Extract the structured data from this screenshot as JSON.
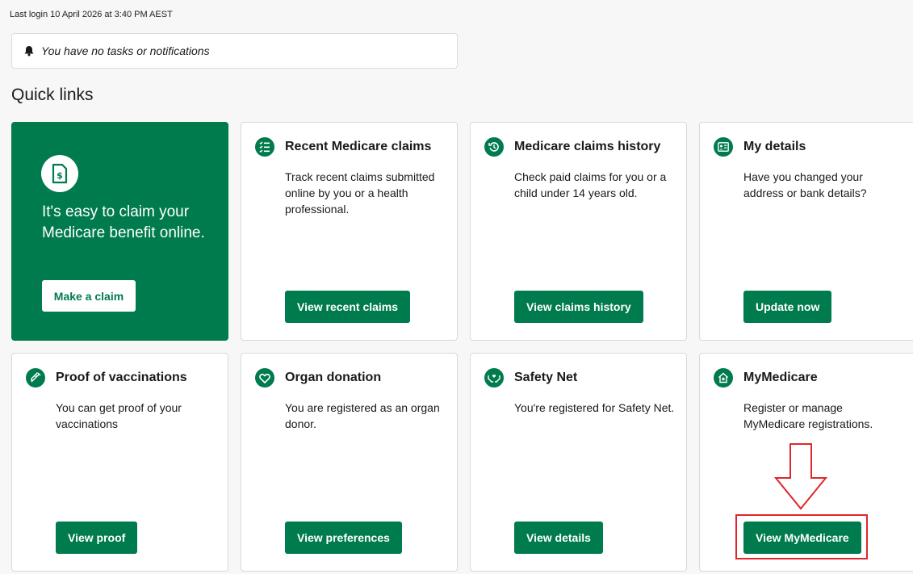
{
  "last_login": "Last login 10 April 2026 at 3:40 PM AEST",
  "notifications": {
    "text": "You have no tasks or notifications",
    "icon": "bell-icon"
  },
  "quick_links": {
    "heading": "Quick links",
    "hero": {
      "icon": "claim-document-icon",
      "text": "It's easy to claim your Medicare benefit online.",
      "button": "Make a claim"
    },
    "cards": [
      {
        "icon": "checklist-icon",
        "title": "Recent Medicare claims",
        "description": "Track recent claims submitted online by you or a health professional.",
        "button": "View recent claims"
      },
      {
        "icon": "history-icon",
        "title": "Medicare claims history",
        "description": "Check paid claims for you or a child under 14 years old.",
        "button": "View claims history"
      },
      {
        "icon": "id-card-icon",
        "title": "My details",
        "description": "Have you changed your address or bank details?",
        "button": "Update now"
      },
      {
        "icon": "syringe-icon",
        "title": "Proof of vaccinations",
        "description": "You can get proof of your vaccinations",
        "button": "View proof"
      },
      {
        "icon": "heart-icon",
        "title": "Organ donation",
        "description": "You are registered as an organ donor.",
        "button": "View preferences"
      },
      {
        "icon": "hands-heart-icon",
        "title": "Safety Net",
        "description": "You're registered for Safety Net.",
        "button": "View details"
      },
      {
        "icon": "house-plus-icon",
        "title": "MyMedicare",
        "description": "Register or manage MyMedicare registrations.",
        "button": "View MyMedicare"
      }
    ]
  },
  "colors": {
    "brand_green": "#007b4d",
    "annotation_red": "#e0262b",
    "background": "#f7f7f7"
  }
}
